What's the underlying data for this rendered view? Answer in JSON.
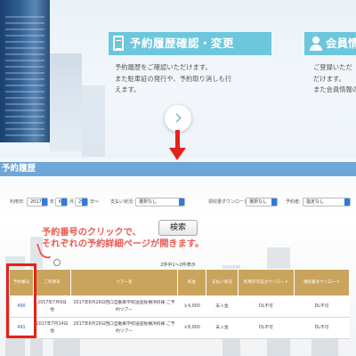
{
  "history_card": {
    "title": "予約履歴確認・変更",
    "desc": [
      "予約履歴をご確認いただけます。",
      "また駐車証の発行や、予約取り消しも行",
      "えます。"
    ]
  },
  "member_card": {
    "title": "会員情",
    "desc": [
      "ご登録いただ",
      "だけます。",
      "また会員情報の"
    ]
  },
  "header": {
    "title": "予約履歴"
  },
  "filters": {
    "date_label": "利用日:",
    "year": "2017",
    "year_unit": "年",
    "month": "6",
    "month_unit": "月",
    "day": "29",
    "day_unit": "日～",
    "payment_label": "支払い状況:",
    "payment_value": "選択なし",
    "receipt_label": "領収書ダウンロード:",
    "receipt_value": "選択なし",
    "booker_label": "予約者:",
    "booker_value": "指定なし"
  },
  "search_button": "検索",
  "annotation": {
    "line1": "予約番号のクリックで、",
    "line2": "それぞれの予約詳細ページが開きます。"
  },
  "result_count": "2件中1〜2件表示",
  "table": {
    "headers": [
      "予約番号",
      "ご利用日",
      "ツアー名",
      "料金",
      "支払い状況",
      "利用許可証ダウンロード",
      "領収書ダウンロード"
    ],
    "rows": [
      [
        "490",
        "2017年7月9日 他",
        "2017年6月29日西口自動車学校送迎駐横浜校様 ご予約ツアー",
        "￥4,000",
        "未入金",
        "DL不可",
        "DL不可"
      ],
      [
        "491",
        "2017年7月14日 他",
        "2017年6月29日西口自動車学校送迎駐横浜校様 ご予約ツアー",
        "￥8,000",
        "未入金",
        "DL不可",
        "DL不可"
      ]
    ]
  },
  "colors": {
    "card_accent": "#6cc7dd",
    "header_bar": "#6fa6d8",
    "table_header": "#c9a45d",
    "highlight_red": "#e3221b",
    "annotation": "#ea5b52",
    "link": "#1b5fb9"
  },
  "icons": [
    "document-icon",
    "user-icon",
    "chevron-right-icon",
    "down-arrow-icon"
  ]
}
